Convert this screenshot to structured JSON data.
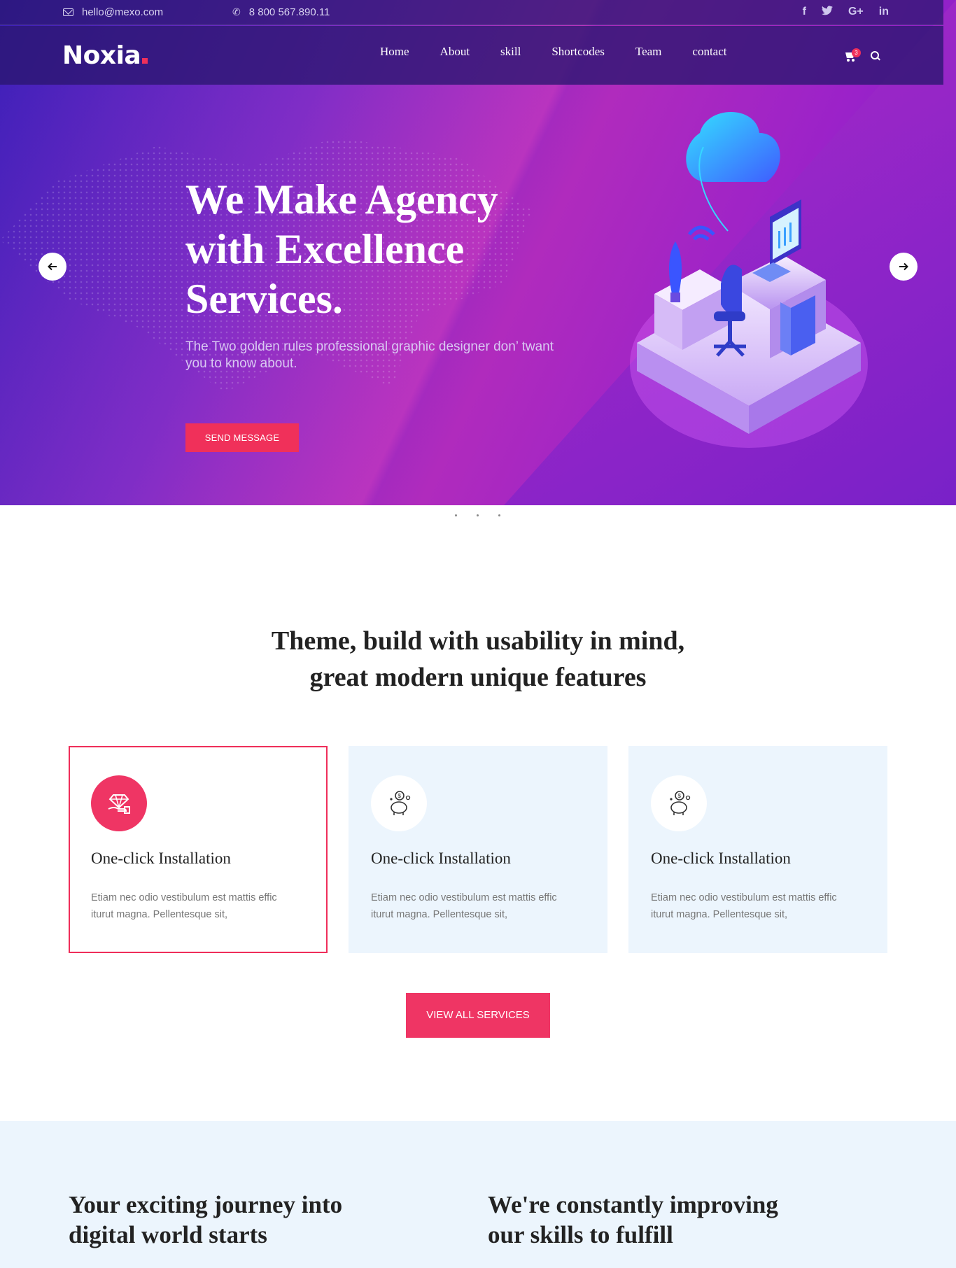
{
  "topbar": {
    "email": "hello@mexo.com",
    "phone": "8 800 567.890.11",
    "social": [
      "f",
      "t",
      "G+",
      "in"
    ]
  },
  "navbar": {
    "logo": "Noxia",
    "menu": [
      "Home",
      "About",
      "skill",
      "Shortcodes",
      "Team",
      "contact"
    ],
    "cart_count": "3"
  },
  "hero": {
    "title_line1": "We Make Agency",
    "title_line2": "with Excellence",
    "title_line3": "Services.",
    "subtitle": "The Two golden rules professional graphic designer don’ twant you to know about.",
    "button": "SEND MESSAGE",
    "prev_icon": "arrow-left-icon",
    "next_icon": "arrow-right-icon"
  },
  "features": {
    "heading_line1": "Theme, build with usability in mind,",
    "heading_line2": "great modern unique features",
    "cards": [
      {
        "title": "One-click Installation",
        "text": "Etiam nec odio vestibulum est mattis effic iturut magna. Pellentesque sit,",
        "icon": "diamond-hand-icon"
      },
      {
        "title": "One-click Installation",
        "text": "Etiam nec odio vestibulum est mattis effic iturut magna. Pellentesque sit,",
        "icon": "piggy-bank-icon"
      },
      {
        "title": "One-click Installation",
        "text": "Etiam nec odio vestibulum est mattis effic iturut magna. Pellentesque sit,",
        "icon": "piggy-bank-icon"
      }
    ],
    "view_all": "VIEW ALL SERVICES"
  },
  "bottom": {
    "left_line1": "Your exciting journey into",
    "left_line2": "digital world starts",
    "right_line1": "We're constantly improving",
    "right_line2": "our skills to fulfill"
  },
  "colors": {
    "accent": "#ef3564",
    "hero_start": "#3a1fb8",
    "hero_end": "#b02bbd",
    "card_bg": "#ecf5fd"
  }
}
